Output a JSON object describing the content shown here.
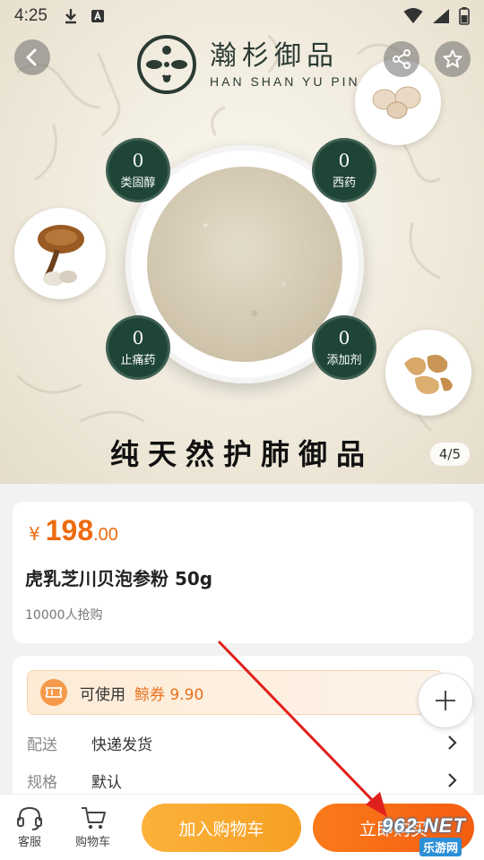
{
  "status_bar": {
    "time": "4:25"
  },
  "brand": {
    "name_cn": "瀚杉御品",
    "name_en": "HAN SHAN YU PIN"
  },
  "hero": {
    "badges": [
      {
        "num": "0",
        "label": "类固醇"
      },
      {
        "num": "0",
        "label": "西药"
      },
      {
        "num": "0",
        "label": "止痛药"
      },
      {
        "num": "0",
        "label": "添加剂"
      }
    ],
    "slogan": "纯天然护肺御品",
    "pager": "4/5"
  },
  "product": {
    "currency": "¥",
    "price_int": "198",
    "price_dec": ".00",
    "title": "虎乳芝川贝泡参粉 50g",
    "sold": "10000人抢购"
  },
  "coupon": {
    "text": "可使用",
    "value": "鲸券 9.90"
  },
  "details": [
    {
      "key": "配送",
      "value": "快递发货"
    },
    {
      "key": "规格",
      "value": "默认"
    }
  ],
  "bottom_bar": {
    "service_label": "客服",
    "cart_label": "购物车",
    "add_to_cart": "加入购物车",
    "buy_now": "立即购买"
  },
  "watermark": {
    "top": "962.NET",
    "bottom": "乐游网"
  },
  "colors": {
    "accent": "#ee6a0f",
    "badge": "#1f4537",
    "cart_button": "#f6a024",
    "buy_button": "#f45d10"
  },
  "icons": [
    "back-icon",
    "share-icon",
    "star-icon",
    "ticket-icon",
    "plus-icon",
    "headset-icon",
    "cart-icon",
    "chevron-right-icon"
  ]
}
